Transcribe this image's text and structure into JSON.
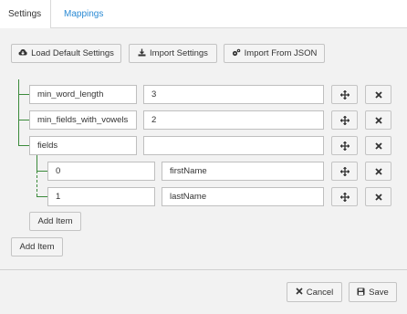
{
  "tabs": [
    {
      "label": "Settings",
      "active": true
    },
    {
      "label": "Mappings",
      "active": false
    }
  ],
  "toolbar": {
    "load_default": "Load Default Settings",
    "import_settings": "Import Settings",
    "import_json": "Import From JSON"
  },
  "rows": [
    {
      "key": "min_word_length",
      "value": "3"
    },
    {
      "key": "min_fields_with_vowels",
      "value": "2"
    },
    {
      "key": "fields",
      "value": ""
    }
  ],
  "nested_rows": [
    {
      "key": "0",
      "value": "firstName"
    },
    {
      "key": "1",
      "value": "lastName"
    }
  ],
  "add_item_label": "Add Item",
  "footer": {
    "cancel": "Cancel",
    "save": "Save"
  },
  "colors": {
    "link": "#2a8ad4",
    "tree_line": "#3a8a3a"
  },
  "icons": {
    "load_default": "cloud-download-icon",
    "import_settings": "download-icon",
    "import_json": "cogs-icon",
    "move": "move-arrows-icon",
    "remove": "close-icon",
    "cancel": "close-icon",
    "save": "floppy-disk-icon"
  }
}
